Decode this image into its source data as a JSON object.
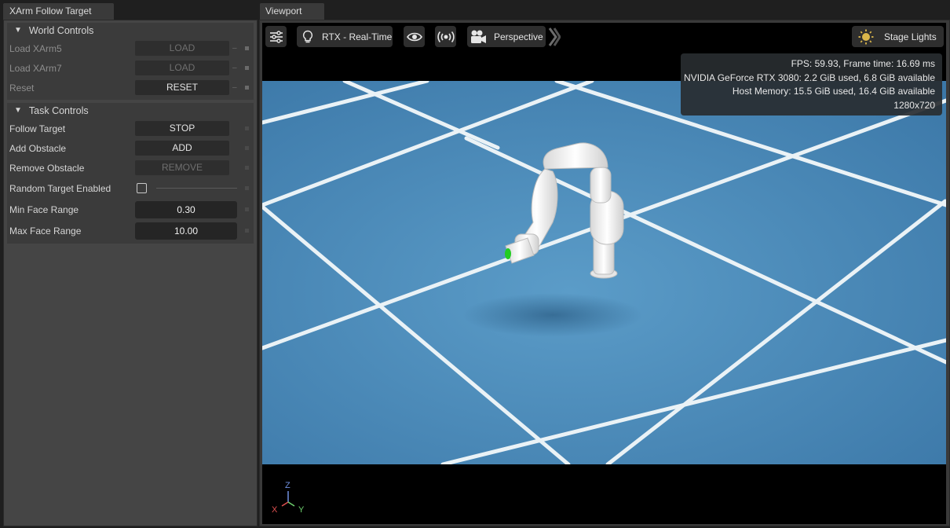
{
  "left_tab": {
    "title": "XArm Follow Target"
  },
  "world_controls": {
    "header": "World Controls",
    "rows": [
      {
        "label": "Load XArm5",
        "button": "LOAD"
      },
      {
        "label": "Load XArm7",
        "button": "LOAD"
      },
      {
        "label": "Reset",
        "button": "RESET"
      }
    ]
  },
  "task_controls": {
    "header": "Task Controls",
    "follow_target": {
      "label": "Follow Target",
      "button": "STOP"
    },
    "add_obstacle": {
      "label": "Add Obstacle",
      "button": "ADD"
    },
    "remove_obstacle": {
      "label": "Remove Obstacle",
      "button": "REMOVE"
    },
    "random_target": {
      "label": "Random Target Enabled",
      "checked": false
    },
    "min_face_range": {
      "label": "Min Face Range",
      "value": "0.30"
    },
    "max_face_range": {
      "label": "Max Face Range",
      "value": "10.00"
    }
  },
  "viewport": {
    "tab": "Viewport",
    "toolbar": {
      "renderer_label": "RTX - Real-Time",
      "camera_label": "Perspective",
      "lights_label": "Stage Lights"
    },
    "stats": {
      "fps": "FPS: 59.93, Frame time: 16.69 ms",
      "gpu": "NVIDIA GeForce RTX 3080: 2.2 GiB used, 6.8 GiB available",
      "host": "Host Memory: 15.5 GiB used, 16.4 GiB available",
      "resolution": "1280x720"
    },
    "axis": {
      "z": "Z",
      "x": "X",
      "y": "Y"
    }
  },
  "colors": {
    "floor": "#4a8ab8",
    "axis_x": "#e05050",
    "axis_y": "#6ed06e",
    "axis_z": "#7090e0",
    "gripper": "#22cc22"
  },
  "icons": [
    "settings-sliders-icon",
    "lightbulb-icon",
    "eye-icon",
    "broadcast-icon",
    "movie-camera-icon",
    "chevron-right-icon",
    "sun-icon"
  ]
}
